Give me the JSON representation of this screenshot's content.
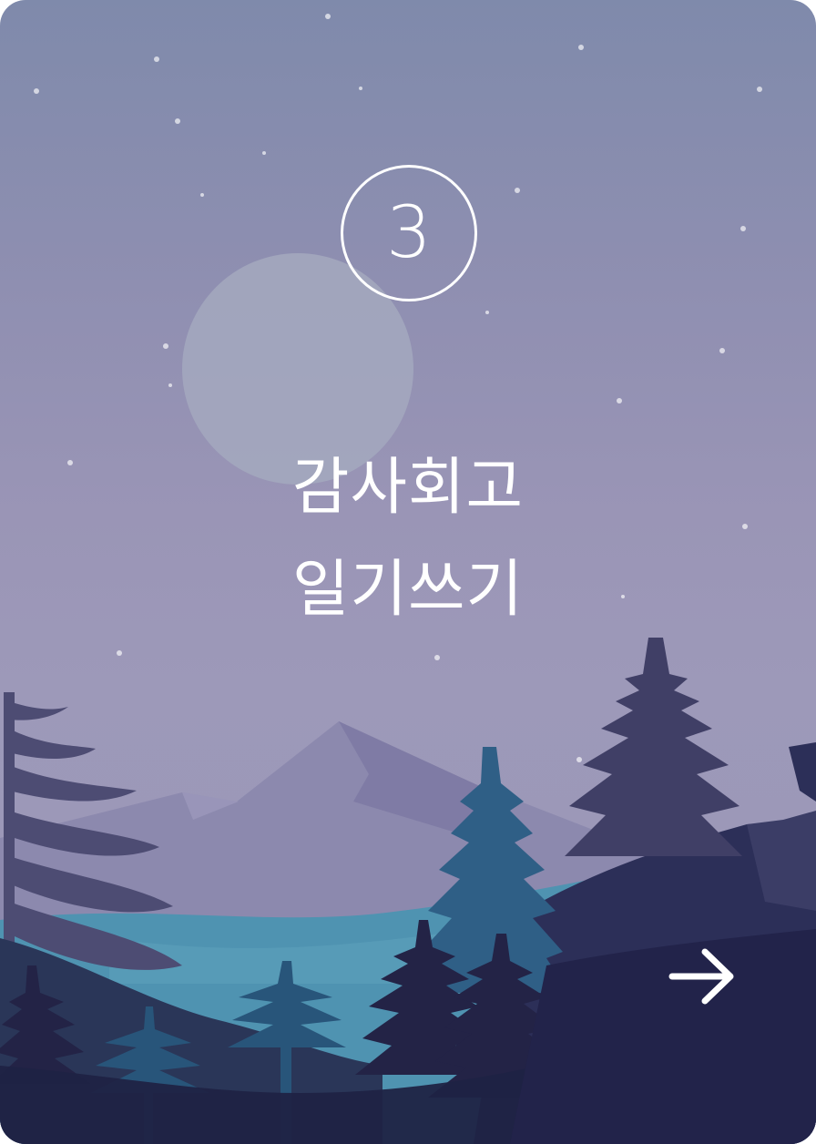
{
  "card": {
    "step_number": "3",
    "title_line1": "감사회고",
    "title_line2": "일기쓰기",
    "next_icon": "arrow-right-icon",
    "background_icon": "night-forest-illustration"
  },
  "colors": {
    "sky_top": "#7f8aab",
    "sky_mid": "#9a95b6",
    "moon": "#a2a6bd",
    "mountain": "#8a86ad",
    "lake": "#4f93b1",
    "tree_teal": "#2f5f86",
    "tree_dark": "#222246",
    "text": "#ffffff"
  }
}
